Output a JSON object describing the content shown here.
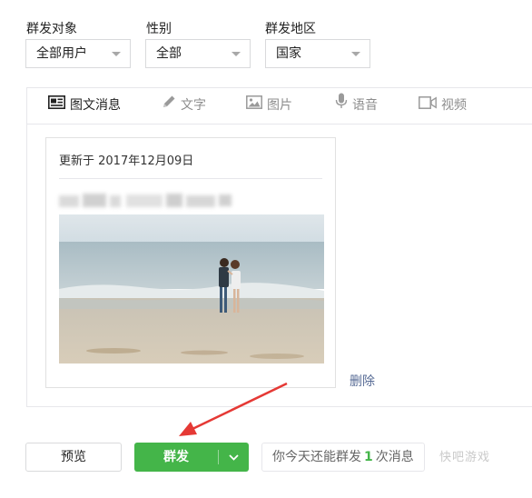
{
  "filters": {
    "target": {
      "label": "群发对象",
      "value": "全部用户"
    },
    "gender": {
      "label": "性别",
      "value": "全部"
    },
    "region": {
      "label": "群发地区",
      "value": "国家"
    }
  },
  "tabs": [
    {
      "label": "图文消息",
      "icon": "news-icon",
      "active": true
    },
    {
      "label": "文字",
      "icon": "pencil-icon",
      "active": false
    },
    {
      "label": "图片",
      "icon": "image-icon",
      "active": false
    },
    {
      "label": "语音",
      "icon": "microphone-icon",
      "active": false
    },
    {
      "label": "视频",
      "icon": "video-icon",
      "active": false
    }
  ],
  "article": {
    "updated": "更新于 2017年12月09日",
    "cover_description": "couple on beach"
  },
  "delete_label": "删除",
  "buttons": {
    "preview": "预览",
    "send": "群发"
  },
  "quota": {
    "prefix": "你今天还能群发",
    "count": "1",
    "suffix": "次消息"
  },
  "watermark": "快吧游戏",
  "colors": {
    "accent": "#44b549",
    "link": "#576b95",
    "annotation_arrow": "#e53935"
  }
}
